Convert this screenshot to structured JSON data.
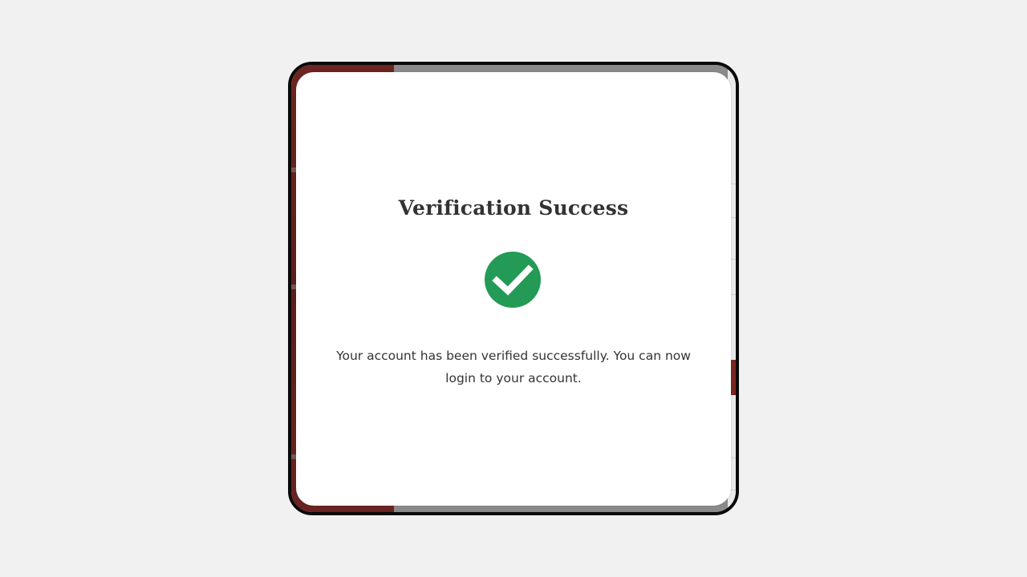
{
  "modal": {
    "title": "Verification Success",
    "message": "Your account has been verified successfully. You can now login to your account.",
    "icon": "check-circle-icon"
  },
  "colors": {
    "page_background": "#f1f1f1",
    "success_green": "#239a55",
    "brand_red": "#6e2420",
    "text": "#333333",
    "overlay": "#8a8a8a"
  }
}
